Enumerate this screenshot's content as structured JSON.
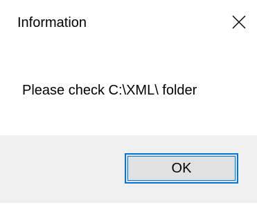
{
  "dialog": {
    "title": "Information",
    "message": "Please check C:\\XML\\ folder",
    "ok_label": "OK"
  },
  "icons": {
    "close": "close-icon"
  },
  "colors": {
    "background": "#ffffff",
    "footer_background": "#f0f0f0",
    "button_background": "#e1e1e1",
    "accent": "#0078d7"
  }
}
